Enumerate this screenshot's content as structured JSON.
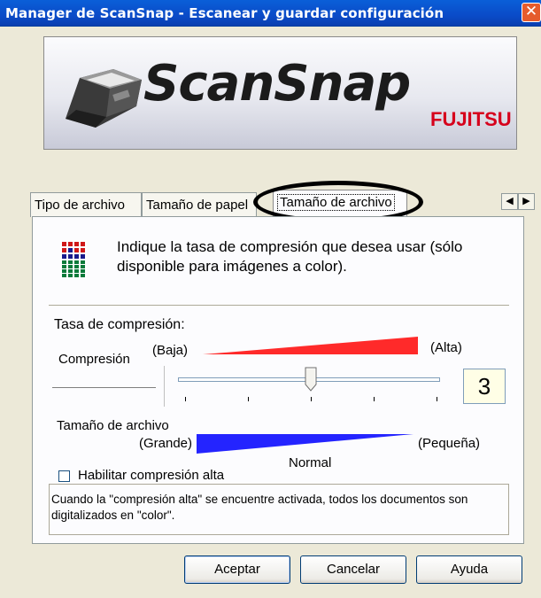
{
  "window": {
    "title": "Manager de ScanSnap - Escanear y guardar configuración",
    "close_label": "✕"
  },
  "banner": {
    "product": "ScanSnap",
    "brand": "FUJITSU",
    "brand_color": "#d6001c"
  },
  "tabs": [
    {
      "label": "Tipo de archivo",
      "selected": false
    },
    {
      "label": "Tamaño de papel",
      "selected": false
    },
    {
      "label": "Tamaño de archivo",
      "selected": true
    }
  ],
  "tab_scroll": {
    "left": "◀",
    "right": "▶"
  },
  "panel": {
    "icon": "compression-grid-icon",
    "instruction": "Indique la tasa de compresión que desea usar (sólo disponible para imágenes a color).",
    "section_label": "Tasa de compresión:",
    "compression_label": "Compresión",
    "compression_low": "(Baja)",
    "compression_high": "(Alta)",
    "compression_color": "#ff2a2a",
    "slider_value": 3,
    "slider_value_text": "3",
    "slider_min": 1,
    "slider_max": 5,
    "file_size_label": "Tamaño de archivo",
    "file_size_large": "(Grande)",
    "file_size_small": "(Pequeña)",
    "file_size_color": "#2424ff",
    "level_name": "Normal",
    "high_compression_label": "Habilitar compresión alta",
    "high_compression_checked": false,
    "note": "Cuando la \"compresión alta\" se encuentre activada, todos los documentos son digitalizados en \"color\"."
  },
  "buttons": {
    "ok": "Aceptar",
    "cancel": "Cancelar",
    "help": "Ayuda"
  }
}
